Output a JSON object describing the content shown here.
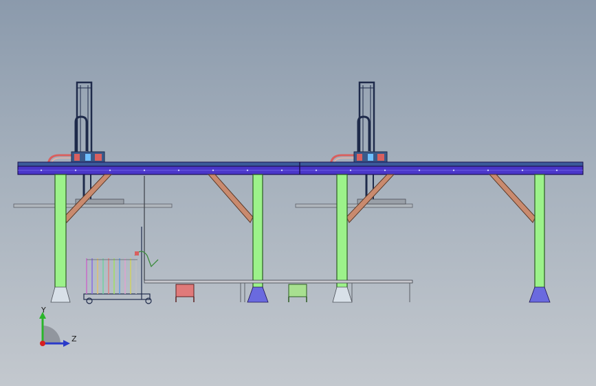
{
  "view": {
    "type": "CAD orthographic side view",
    "background": {
      "top": "#8b9aac",
      "bottom": "#c3c8ce"
    }
  },
  "colors": {
    "beam": "#4a36c9",
    "beam_edge": "#1c1150",
    "column": "#9cf28a",
    "brace": "#c98a6e",
    "carriage_frame": "#1e2a4a",
    "cable": "#d8605f",
    "workpiece": "#b0b6bc",
    "base_plate": "#6a6adf",
    "conveyor": "#c8c8ce",
    "stand_red": "#e07a7a",
    "stand_green": "#a8e090"
  },
  "triad": {
    "y_label": "Y",
    "z_label": "Z",
    "y_color": "#2ab52a",
    "z_color": "#2a3ac9",
    "origin_color": "#d62020"
  }
}
